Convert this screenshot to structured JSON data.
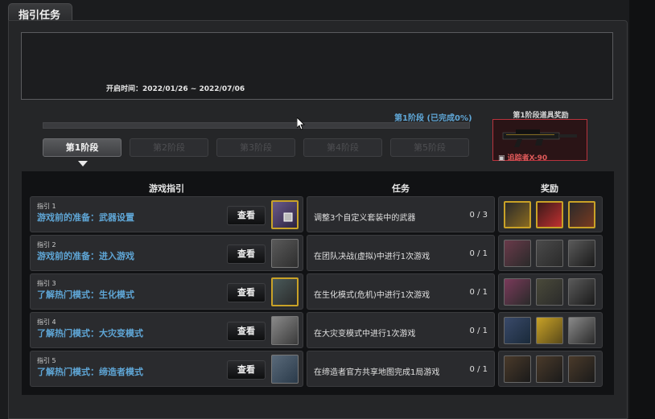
{
  "window": {
    "title": "指引任务"
  },
  "info": {
    "open_time": "开启时间：2022/01/26 ~ 2022/07/06"
  },
  "progress": {
    "status": "第1阶段 (已完成0%)",
    "fraction": 0.0
  },
  "stages": [
    {
      "label": "第1阶段",
      "active": true
    },
    {
      "label": "第2阶段",
      "active": false
    },
    {
      "label": "第3阶段",
      "active": false
    },
    {
      "label": "第4阶段",
      "active": false
    },
    {
      "label": "第5阶段",
      "active": false
    }
  ],
  "stage_reward": {
    "label": "第1阶段道具奖励",
    "item_name": "追踪者X-90"
  },
  "table": {
    "headers": {
      "guide": "游戏指引",
      "task": "任务",
      "reward": "奖励"
    },
    "view_label": "查看",
    "rows": [
      {
        "guide_index": "指引 1",
        "guide_name": "游戏前的准备：武器设置",
        "task": "调整3个自定义套装中的武器",
        "count": "0 / 3"
      },
      {
        "guide_index": "指引 2",
        "guide_name": "游戏前的准备：进入游戏",
        "task": "在团队决战(虚拟)中进行1次游戏",
        "count": "0 / 1"
      },
      {
        "guide_index": "指引 3",
        "guide_name": "了解热门模式：生化模式",
        "task": "在生化模式(危机)中进行1次游戏",
        "count": "0 / 1"
      },
      {
        "guide_index": "指引 4",
        "guide_name": "了解热门模式：大灾变模式",
        "task": "在大灾变模式中进行1次游戏",
        "count": "0 / 1"
      },
      {
        "guide_index": "指引 5",
        "guide_name": "了解热门模式：缔造者模式",
        "task": "在缔造者官方共享地图完成1局游戏",
        "count": "0 / 1"
      }
    ]
  },
  "colors": {
    "accent": "#5fa6d6",
    "reward_border": "#b8333d",
    "gold": "#c9a227"
  }
}
